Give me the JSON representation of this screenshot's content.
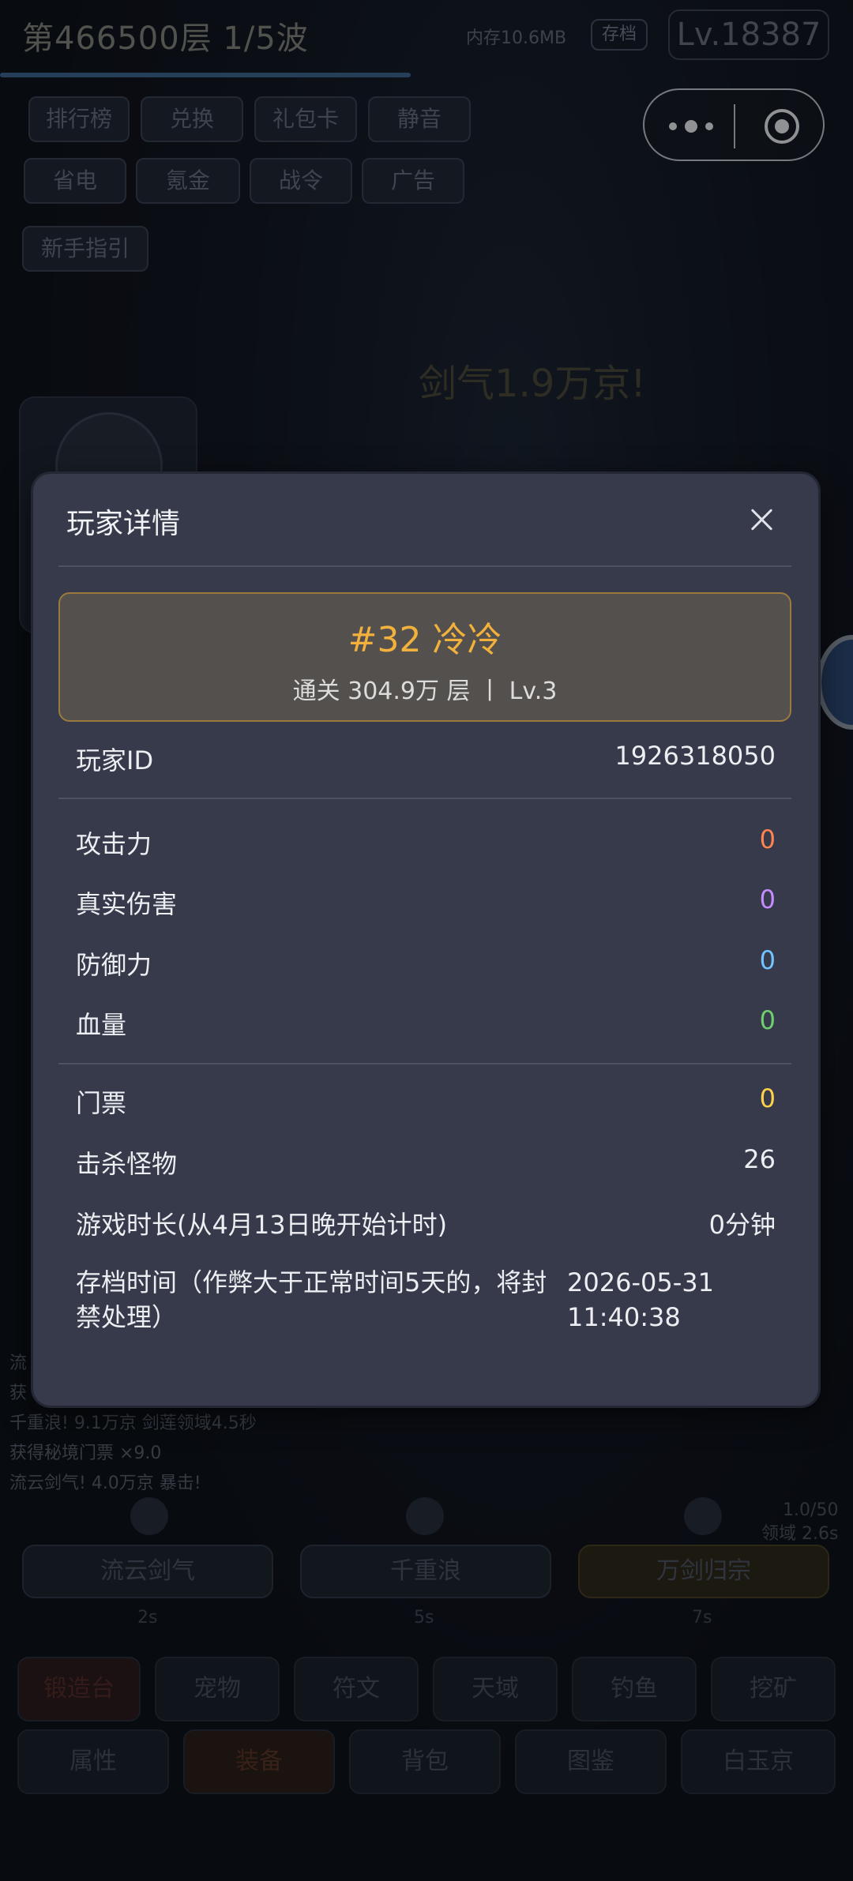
{
  "background": {
    "floor_text": "第466500层  1/5波",
    "memory_text": "内存10.6MB",
    "save_chip": "存档",
    "level_chip": "Lv.18387",
    "menu_row1": [
      "排行榜",
      "兑换",
      "礼包卡",
      "静音"
    ],
    "menu_row2": [
      "省电",
      "氪金",
      "战令",
      "广告"
    ],
    "guide_button": "新手指引",
    "damage_text": "剑气1.9万京!",
    "log_lines": [
      "流",
      "获",
      "千重浪! 9.1万京 剑莲领域4.5秒",
      "获得秘境门票 ×9.0",
      "流云剑气! 4.0万京 暴击!"
    ],
    "skills": [
      {
        "name": "流云剑气",
        "time": "2s"
      },
      {
        "name": "千重浪",
        "time": "5s"
      },
      {
        "name": "万剑归宗",
        "time": "7s"
      }
    ],
    "side_stats": [
      "1.0/50",
      "领域 2.6s"
    ],
    "nav_row1": [
      "锻造台",
      "宠物",
      "符文",
      "天域",
      "钓鱼",
      "挖矿"
    ],
    "nav_row2": [
      "属性",
      "装备",
      "背包",
      "图鉴",
      "白玉京"
    ]
  },
  "modal": {
    "title": "玩家详情",
    "player": {
      "name_line": "#32 冷冷",
      "sub_line": "通关 304.9万 层 丨 Lv.3"
    },
    "player_id_label": "玩家ID",
    "player_id_value": "1926318050",
    "stats": [
      {
        "label": "攻击力",
        "value": "0",
        "color": "#ff8452"
      },
      {
        "label": "真实伤害",
        "value": "0",
        "color": "#c68cff"
      },
      {
        "label": "防御力",
        "value": "0",
        "color": "#72c4ff"
      },
      {
        "label": "血量",
        "value": "0",
        "color": "#6ed06c"
      }
    ],
    "extra": [
      {
        "label": "门票",
        "value": "0"
      },
      {
        "label": "击杀怪物",
        "value": "26"
      },
      {
        "label": "游戏时长(从4月13日晚开始计时)",
        "value": "0分钟"
      }
    ],
    "save_time_label": "存档时间（作弊大于正常时间5天的，将封禁处理）",
    "save_time_value": "2026-05-31 11:40:38"
  },
  "colors": {
    "accent_gold": "#f2b13c",
    "modal_bg": "#363a4a"
  }
}
